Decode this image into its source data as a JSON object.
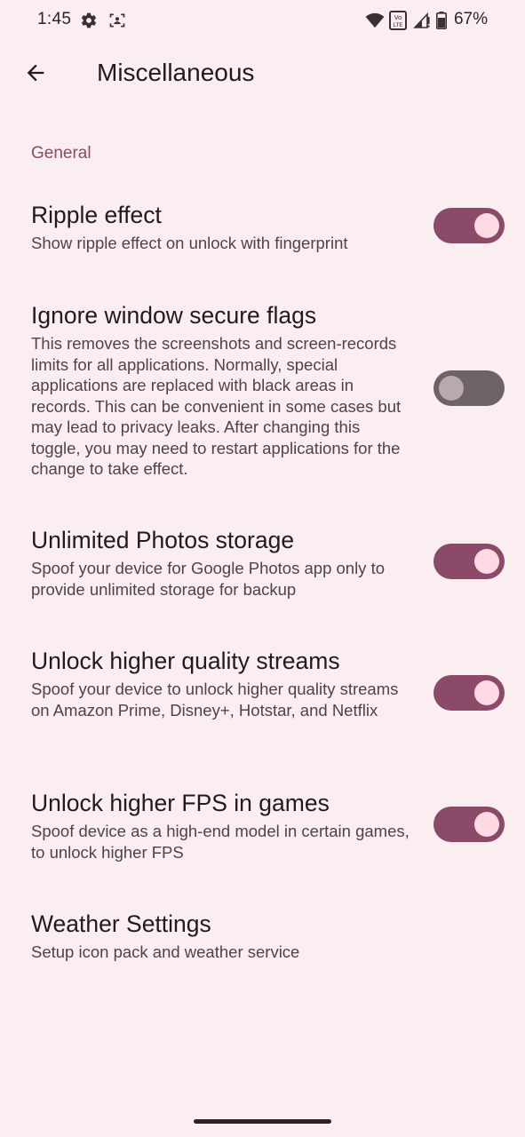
{
  "status_bar": {
    "time": "1:45",
    "battery_percent": "67%",
    "icons": [
      "gear-icon",
      "face-scan-icon",
      "wifi-icon",
      "volte-icon",
      "signal-icon",
      "battery-icon"
    ]
  },
  "app_bar": {
    "title": "Miscellaneous",
    "back_icon": "arrow-back-icon"
  },
  "category": {
    "title": "General"
  },
  "preferences": [
    {
      "title": "Ripple effect",
      "summary": "Show ripple effect on unlock with fingerprint",
      "checked": true
    },
    {
      "title": "Ignore window secure flags",
      "summary": "This removes the screenshots and screen-records limits for all applications. Normally, special applications are replaced with black areas in records. This can be convenient in some cases but may lead to privacy leaks. After changing this toggle, you may need to restart applications for the change to take effect.",
      "checked": false
    },
    {
      "title": "Unlimited Photos storage",
      "summary": "Spoof your device for Google Photos app only to provide unlimited storage for backup",
      "checked": true
    },
    {
      "title": "Unlock higher quality streams",
      "summary": "Spoof your device to unlock higher quality streams on Amazon Prime, Disney+, Hotstar, and Netflix",
      "checked": true
    },
    {
      "title": "Unlock higher FPS in games",
      "summary": "Spoof device as a high-end model in certain games, to unlock higher FPS",
      "checked": true
    },
    {
      "title": "Weather Settings",
      "summary": "Setup icon pack and weather service"
    }
  ],
  "colors": {
    "background": "#fbeef0",
    "accent": "#8b4a67",
    "switch_thumb_on": "#ffd9e4",
    "switch_track_off": "#6e6366",
    "category_text": "#8a4a67"
  }
}
